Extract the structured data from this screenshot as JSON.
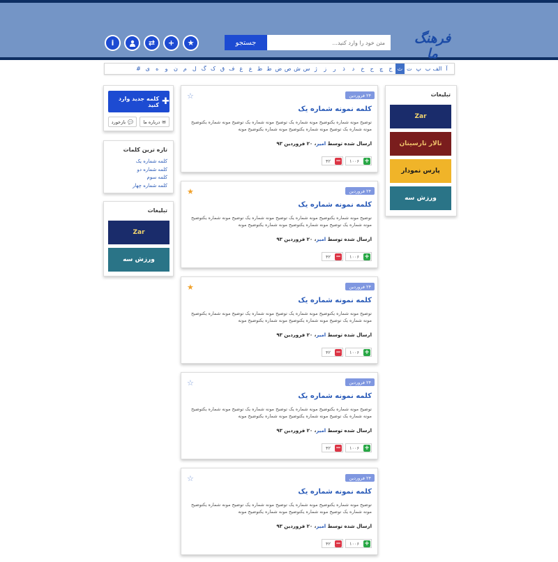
{
  "header": {
    "logo": "فرهنگ ما",
    "search_button": "جستجو",
    "search_placeholder": "متن خود را وارد کنید...",
    "nav_icons": [
      "info-icon",
      "user-icon",
      "shuffle-icon",
      "plus-icon",
      "star-icon"
    ]
  },
  "alphabet": [
    "آ",
    "الف",
    "ب",
    "پ",
    "ت",
    "ث",
    "ج",
    "چ",
    "ح",
    "خ",
    "د",
    "ذ",
    "ر",
    "ز",
    "ژ",
    "س",
    "ش",
    "ص",
    "ض",
    "ط",
    "ظ",
    "ع",
    "غ",
    "ف",
    "ق",
    "ک",
    "گ",
    "ل",
    "م",
    "ن",
    "و",
    "ه",
    "ی",
    "#"
  ],
  "alphabet_active": "ث",
  "sidebar_right": {
    "title": "تبلیغات",
    "ads": [
      {
        "text": "Zar",
        "bg": "#1a2c6b",
        "fg": "#f5d76e"
      },
      {
        "text": "تالار تارسیتان",
        "bg": "#7a1d1d",
        "fg": "#f0c36b"
      },
      {
        "text": "پارس نمودار",
        "bg": "#f0b429",
        "fg": "#1a1a1a"
      },
      {
        "text": "ورزش سه",
        "bg": "#2a7487",
        "fg": "#ffffff"
      }
    ]
  },
  "sidebar_left": {
    "add_word": "کلمه جدید وارد کنید",
    "about": "درباره ما",
    "feedback": "بازخورد",
    "recent_title": "تازه ترین کلمات",
    "recent": [
      "کلمه شماره یک",
      "کلمه شماره دو",
      "کلمه سوم",
      "کلمه شماره چهار"
    ],
    "ads_title": "تبلیغات",
    "ads": [
      {
        "text": "Zar",
        "bg": "#1a2c6b",
        "fg": "#f5d76e"
      },
      {
        "text": "ورزش سه",
        "bg": "#2a7487",
        "fg": "#ffffff"
      }
    ]
  },
  "cards": [
    {
      "date": "۲۴ فروردین",
      "title": "کلمه نمونه شماره یک",
      "desc": "توضیح مونه شماره یکتوضیح مونه شماره یک توضیح مونه شماره یک توضیح مونه شماره یکتوضیح مونه شماره یک توضیح مونه شماره یکتوضیح مونه شماره یکتوضیح مونه",
      "sent_by": "ارسال شده توسط",
      "author": "امیر",
      "sent_date": "، ۲۰ فروردین ۹۳",
      "up": "۱۰۰۶",
      "down": "۴۲",
      "starred": false
    },
    {
      "date": "۲۴ فروردین",
      "title": "کلمه نمونه شماره یک",
      "desc": "توضیح مونه شماره یکتوضیح مونه شماره یک توضیح مونه شماره یک توضیح مونه شماره یکتوضیح مونه شماره یک توضیح مونه شماره یکتوضیح مونه شماره یکتوضیح مونه",
      "sent_by": "ارسال شده توسط",
      "author": "امیر",
      "sent_date": "، ۲۰ فروردین ۹۳",
      "up": "۱۰۰۶",
      "down": "۴۲",
      "starred": true
    },
    {
      "date": "۲۴ فروردین",
      "title": "کلمه نمونه شماره یک",
      "desc": "توضیح مونه شماره یکتوضیح مونه شماره یک توضیح مونه شماره یک توضیح مونه شماره یکتوضیح مونه شماره یک توضیح مونه شماره یکتوضیح مونه شماره یکتوضیح مونه",
      "sent_by": "ارسال شده توسط",
      "author": "امیر",
      "sent_date": "، ۲۰ فروردین ۹۳",
      "up": "۱۰۰۶",
      "down": "۴۲",
      "starred": true
    },
    {
      "date": "۲۴ فروردین",
      "title": "کلمه نمونه شماره یک",
      "desc": "توضیح مونه شماره یکتوضیح مونه شماره یک توضیح مونه شماره یک توضیح مونه شماره یکتوضیح مونه شماره یک توضیح مونه شماره یکتوضیح مونه شماره یکتوضیح مونه",
      "sent_by": "ارسال شده توسط",
      "author": "امیر",
      "sent_date": "، ۲۰ فروردین ۹۳",
      "up": "۱۰۰۶",
      "down": "۴۲",
      "starred": false
    },
    {
      "date": "۲۴ فروردین",
      "title": "کلمه نمونه شماره یک",
      "desc": "توضیح مونه شماره یکتوضیح مونه شماره یک توضیح مونه شماره یک توضیح مونه شماره یکتوضیح مونه شماره یک توضیح مونه شماره یکتوضیح مونه شماره یکتوضیح مونه",
      "sent_by": "ارسال شده توسط",
      "author": "امیر",
      "sent_date": "، ۲۰ فروردین ۹۳",
      "up": "۱۰۰۶",
      "down": "۴۲",
      "starred": false
    }
  ]
}
